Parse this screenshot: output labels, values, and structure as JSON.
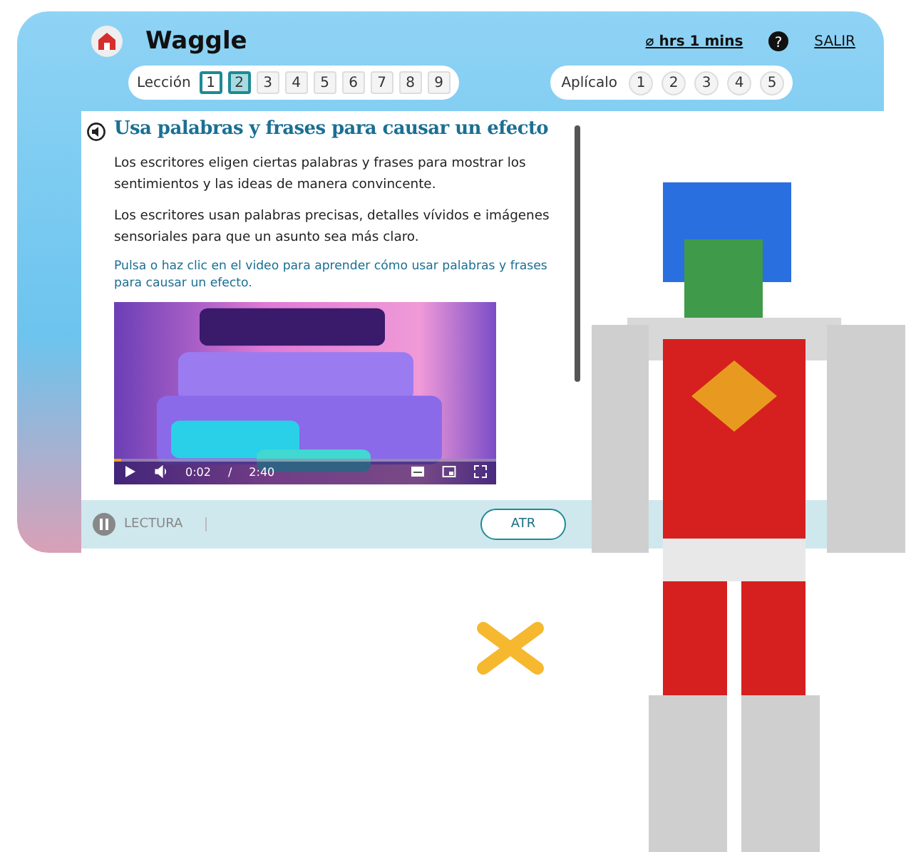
{
  "header": {
    "app_name": "Waggle",
    "timer": "⌀ hrs 1 mins",
    "help": "?",
    "exit": "SALIR"
  },
  "lesson_nav": {
    "label": "Lección",
    "items": [
      {
        "label": "1",
        "selected": false,
        "visited": true
      },
      {
        "label": "2",
        "selected": true,
        "visited": true
      },
      {
        "label": "3",
        "selected": false,
        "visited": false
      },
      {
        "label": "4",
        "selected": false,
        "visited": false
      },
      {
        "label": "5",
        "selected": false,
        "visited": false
      },
      {
        "label": "6",
        "selected": false,
        "visited": false
      },
      {
        "label": "7",
        "selected": false,
        "visited": false
      },
      {
        "label": "8",
        "selected": false,
        "visited": false
      },
      {
        "label": "9",
        "selected": false,
        "visited": false
      }
    ]
  },
  "apply_nav": {
    "label": "Aplícalo",
    "items": [
      {
        "label": "1",
        "selected": false
      },
      {
        "label": "2",
        "selected": false
      },
      {
        "label": "3",
        "selected": false
      },
      {
        "label": "4",
        "selected": false
      },
      {
        "label": "5",
        "selected": false
      }
    ]
  },
  "lesson": {
    "title": "Usa palabras y frases para causar un efecto",
    "paragraphs": [
      "Los escritores eligen ciertas palabras y frases para mostrar los sentimientos y las ideas de manera convincente.",
      "Los escritores usan palabras precisas, detalles vívidos e imágenes sensoriales para que un asunto sea más claro."
    ],
    "instruction": "Pulsa o haz clic en el video para aprender cómo usar palabras y frases para causar un efecto.",
    "video": {
      "level": 0.02,
      "current_time": "0:02",
      "separator": "/",
      "duration": "2:40"
    }
  },
  "footer": {
    "reading": "LECTURA",
    "back_button": "ATR"
  }
}
